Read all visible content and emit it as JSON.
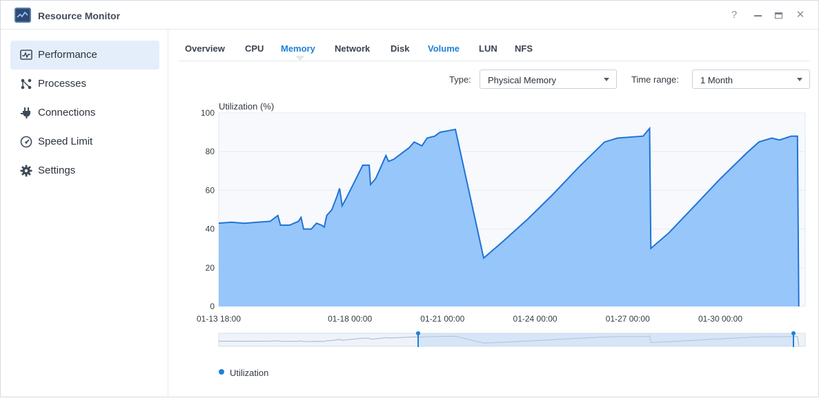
{
  "window": {
    "title": "Resource Monitor",
    "controls": {
      "help": "?",
      "minimize": "—",
      "maximize": "▭",
      "close": "✕"
    }
  },
  "sidebar": {
    "items": [
      {
        "label": "Performance",
        "icon": "performance-icon",
        "active": true
      },
      {
        "label": "Processes",
        "icon": "processes-icon",
        "active": false
      },
      {
        "label": "Connections",
        "icon": "plug-icon",
        "active": false
      },
      {
        "label": "Speed Limit",
        "icon": "gauge-icon",
        "active": false
      },
      {
        "label": "Settings",
        "icon": "gear-icon",
        "active": false
      }
    ]
  },
  "tabs": [
    {
      "label": "Overview"
    },
    {
      "label": "CPU"
    },
    {
      "label": "Memory",
      "selected": true
    },
    {
      "label": "Network"
    },
    {
      "label": "Disk"
    },
    {
      "label": "Volume",
      "highlight": true
    },
    {
      "label": "LUN"
    },
    {
      "label": "NFS"
    }
  ],
  "controls": {
    "type_label": "Type:",
    "type_value": "Physical Memory",
    "range_label": "Time range:",
    "range_value": "1 Month"
  },
  "colors": {
    "accent": "#1f7fd8",
    "area_fill": "#91c3fa",
    "line": "#1f73d6",
    "plot_bg": "#f7f9fd"
  },
  "chart_data": {
    "type": "area",
    "ylabel": "Utilization (%)",
    "ylim": [
      0,
      100
    ],
    "yticks": [
      0,
      20,
      40,
      60,
      80,
      100
    ],
    "x_tick_labels": [
      "01-13 18:00",
      "01-18 00:00",
      "01-21 00:00",
      "01-24 00:00",
      "01-27 00:00",
      "01-30 00:00"
    ],
    "x_unit": "hours since 01-13 18:00",
    "xlim": [
      0,
      456
    ],
    "x_ticks": [
      0,
      102,
      174,
      246,
      318,
      390
    ],
    "legend": "bottom-left",
    "series": [
      {
        "name": "Utilization",
        "points": [
          [
            0,
            43
          ],
          [
            10,
            43.5
          ],
          [
            20,
            43
          ],
          [
            30,
            43.5
          ],
          [
            40,
            44
          ],
          [
            46,
            47
          ],
          [
            48,
            42
          ],
          [
            55,
            42
          ],
          [
            62,
            44
          ],
          [
            64,
            46
          ],
          [
            66,
            40
          ],
          [
            72,
            40
          ],
          [
            76,
            43
          ],
          [
            80,
            42
          ],
          [
            82,
            41
          ],
          [
            84,
            47
          ],
          [
            88,
            50
          ],
          [
            92,
            57
          ],
          [
            94,
            61
          ],
          [
            96,
            52
          ],
          [
            100,
            57
          ],
          [
            106,
            65
          ],
          [
            112,
            73
          ],
          [
            117,
            73
          ],
          [
            118,
            63
          ],
          [
            122,
            66
          ],
          [
            126,
            72
          ],
          [
            130,
            78
          ],
          [
            132,
            75
          ],
          [
            136,
            76
          ],
          [
            140,
            78
          ],
          [
            144,
            80
          ],
          [
            148,
            82
          ],
          [
            152,
            85
          ],
          [
            158,
            83
          ],
          [
            162,
            87
          ],
          [
            168,
            88
          ],
          [
            172,
            90
          ],
          [
            180,
            91
          ],
          [
            184,
            91.5
          ],
          [
            206,
            25
          ],
          [
            220,
            33
          ],
          [
            240,
            45
          ],
          [
            260,
            58
          ],
          [
            280,
            72
          ],
          [
            300,
            85
          ],
          [
            310,
            87
          ],
          [
            330,
            88
          ],
          [
            335,
            92
          ],
          [
            336,
            30
          ],
          [
            350,
            38
          ],
          [
            370,
            52
          ],
          [
            390,
            66
          ],
          [
            410,
            79
          ],
          [
            420,
            85
          ],
          [
            430,
            87
          ],
          [
            436,
            86
          ],
          [
            445,
            88
          ],
          [
            450,
            88
          ],
          [
            451,
            0
          ]
        ]
      }
    ]
  },
  "navigator": {
    "range_start_pct": 34,
    "range_end_pct": 98
  }
}
